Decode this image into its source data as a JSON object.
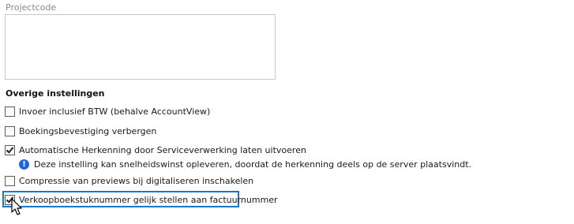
{
  "projectcode": {
    "label": "Projectcode",
    "value": ""
  },
  "section": {
    "title": "Overige instellingen"
  },
  "options": [
    {
      "label": "Invoer inclusief BTW (behalve AccountView)",
      "checked": false
    },
    {
      "label": "Boekingsbevestiging verbergen",
      "checked": false
    },
    {
      "label": "Automatische Herkenning door Serviceverwerking laten uitvoeren",
      "checked": true
    },
    {
      "label": "Compressie van previews bij digitaliseren inschakelen",
      "checked": false
    },
    {
      "label": "Verkoopboekstuknummer gelijk stellen aan factuurnummer",
      "checked": true
    }
  ],
  "info": {
    "icon": "info-icon",
    "text": "Deze instelling kan snelheidswinst opleveren, doordat de herkenning deels op de server plaatsvindt."
  },
  "colors": {
    "focus": "#1a78c8",
    "info_icon": "#1e66d6",
    "field_label": "#8a8a8a"
  }
}
